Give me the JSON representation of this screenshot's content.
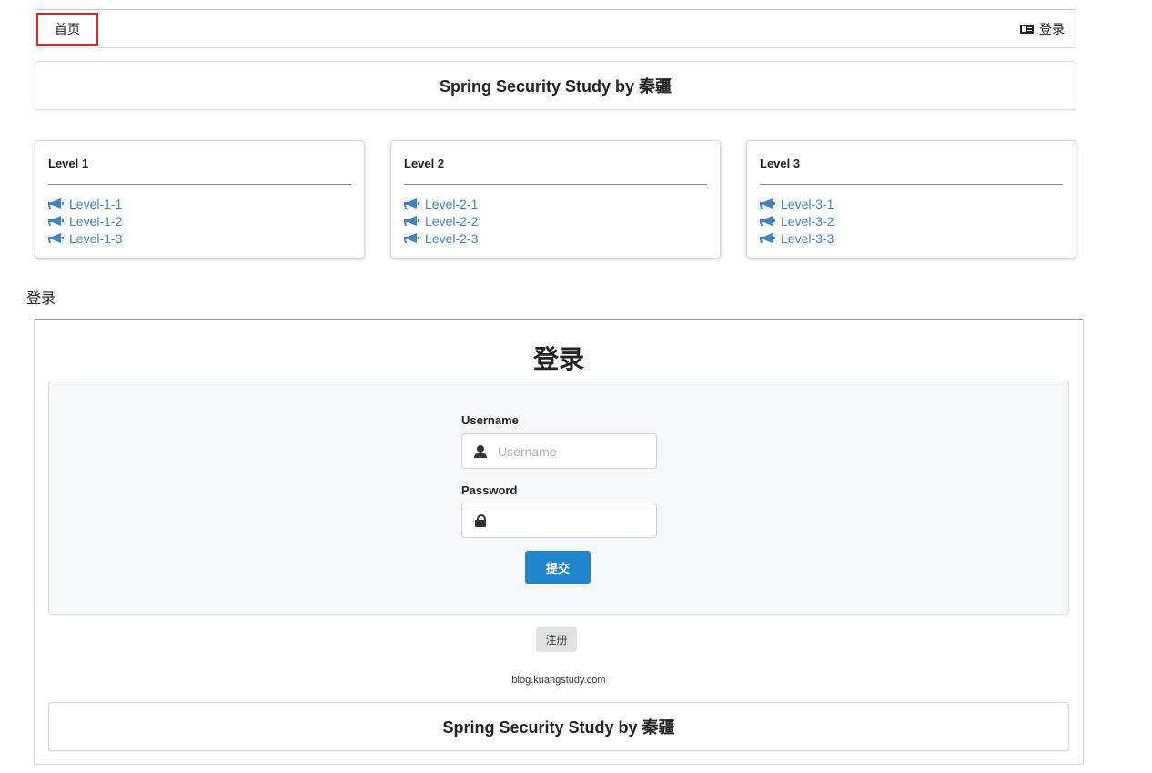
{
  "nav": {
    "home_label": "首页",
    "login_label": "登录",
    "login_icon": "id-card-icon"
  },
  "header": {
    "title": "Spring Security Study by 秦疆"
  },
  "levels": [
    {
      "title": "Level 1",
      "links": [
        "Level-1-1",
        "Level-1-2",
        "Level-1-3"
      ]
    },
    {
      "title": "Level 2",
      "links": [
        "Level-2-1",
        "Level-2-2",
        "Level-2-3"
      ]
    },
    {
      "title": "Level 3",
      "links": [
        "Level-3-1",
        "Level-3-2",
        "Level-3-3"
      ]
    }
  ],
  "section_label": "登录",
  "login": {
    "heading": "登录",
    "username": {
      "label": "Username",
      "placeholder": "Username",
      "value": "",
      "icon": "user-icon"
    },
    "password": {
      "label": "Password",
      "placeholder": "",
      "value": "",
      "icon": "lock-icon"
    },
    "submit_label": "提交",
    "register_label": "注册",
    "blog_link": "blog.kuangstudy.com",
    "footer_title": "Spring Security Study by 秦疆"
  },
  "colors": {
    "link": "#4183c4",
    "primary_button": "#2185d0",
    "highlight_border": "#e0242a"
  }
}
